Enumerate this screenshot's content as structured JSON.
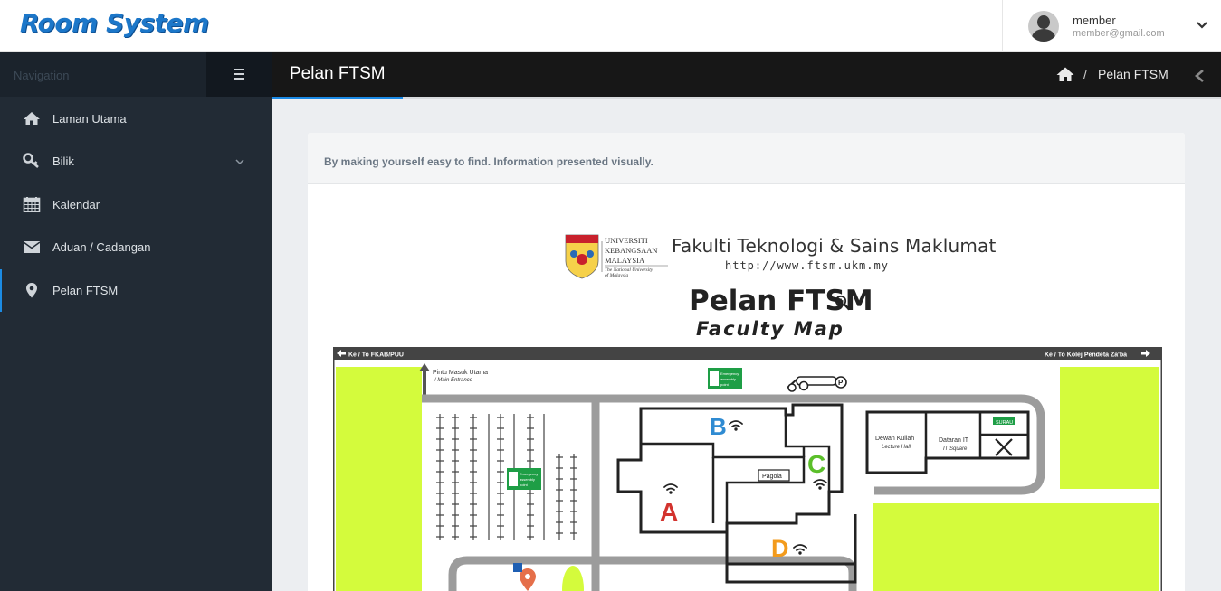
{
  "header": {
    "brand": "Room System",
    "user": {
      "name": "member",
      "email": "member@gmail.com"
    }
  },
  "sidebar": {
    "title": "Navigation",
    "items": [
      {
        "label": "Laman Utama",
        "icon": "home-icon"
      },
      {
        "label": "Bilik",
        "icon": "key-icon",
        "has_submenu": true
      },
      {
        "label": "Kalendar",
        "icon": "calendar-icon"
      },
      {
        "label": "Aduan / Cadangan",
        "icon": "envelope-icon"
      },
      {
        "label": "Pelan FTSM",
        "icon": "map-marker-icon",
        "active": true
      }
    ]
  },
  "page": {
    "title": "Pelan FTSM",
    "breadcrumb": {
      "separator": "/",
      "current": "Pelan FTSM"
    },
    "panel_subtitle": "By making yourself easy to find. Information presented visually."
  },
  "map": {
    "university_lines": [
      "UNIVERSITI",
      "KEBANGSAAN",
      "MALAYSIA"
    ],
    "university_tagline": [
      "The National University",
      "of Malaysia"
    ],
    "faculty_name": "Fakulti Teknologi & Sains Maklumat",
    "faculty_url": "http://www.ftsm.ukm.my",
    "title": "Pelan FTSM",
    "subtitle": "Faculty Map",
    "left_direction": "Ke / To FKAB/PUU",
    "right_direction": "Ke / To Kolej Pendeta Za'ba",
    "main_entrance": "Pintu Masuk Utama",
    "main_entrance_en": "/ Main Entrance",
    "assembly_point": [
      "Emergency",
      "assembly",
      "point"
    ],
    "blocks": [
      "A",
      "B",
      "C",
      "D"
    ],
    "block_colors": {
      "A": "#d3332e",
      "B": "#2f8bd2",
      "C": "#5bbf2a",
      "D": "#f39b1c"
    },
    "pagoda": "Pagola",
    "lecture_hall": "Dewan Kuliah",
    "lecture_hall_en": "Lecture Hall",
    "it_square": "Dataran IT",
    "it_square_en": "IT Square",
    "surau": "SURAU",
    "parking_label": "P",
    "accent_colors": {
      "grass": "#d4fb3c",
      "road": "#9c9c9c",
      "emergency": "#1e9e46"
    }
  }
}
